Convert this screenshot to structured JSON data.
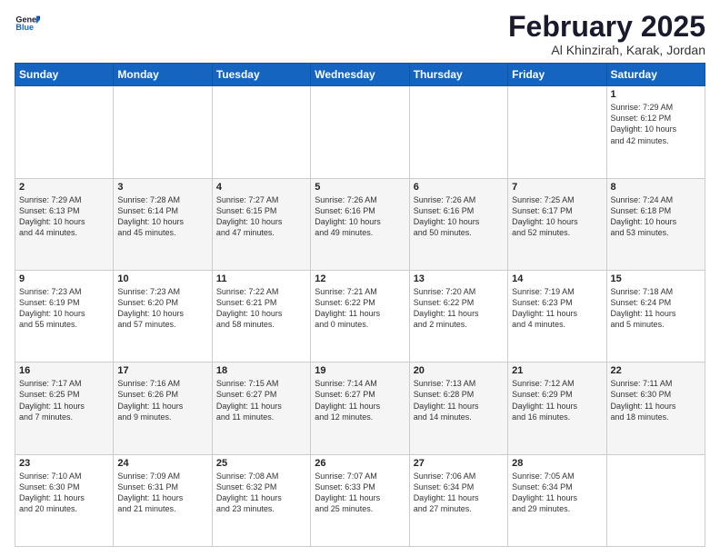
{
  "header": {
    "logo_line1": "General",
    "logo_line2": "Blue",
    "title": "February 2025",
    "subtitle": "Al Khinzirah, Karak, Jordan"
  },
  "weekdays": [
    "Sunday",
    "Monday",
    "Tuesday",
    "Wednesday",
    "Thursday",
    "Friday",
    "Saturday"
  ],
  "weeks": [
    [
      {
        "day": "",
        "info": ""
      },
      {
        "day": "",
        "info": ""
      },
      {
        "day": "",
        "info": ""
      },
      {
        "day": "",
        "info": ""
      },
      {
        "day": "",
        "info": ""
      },
      {
        "day": "",
        "info": ""
      },
      {
        "day": "1",
        "info": "Sunrise: 7:29 AM\nSunset: 6:12 PM\nDaylight: 10 hours\nand 42 minutes."
      }
    ],
    [
      {
        "day": "2",
        "info": "Sunrise: 7:29 AM\nSunset: 6:13 PM\nDaylight: 10 hours\nand 44 minutes."
      },
      {
        "day": "3",
        "info": "Sunrise: 7:28 AM\nSunset: 6:14 PM\nDaylight: 10 hours\nand 45 minutes."
      },
      {
        "day": "4",
        "info": "Sunrise: 7:27 AM\nSunset: 6:15 PM\nDaylight: 10 hours\nand 47 minutes."
      },
      {
        "day": "5",
        "info": "Sunrise: 7:26 AM\nSunset: 6:16 PM\nDaylight: 10 hours\nand 49 minutes."
      },
      {
        "day": "6",
        "info": "Sunrise: 7:26 AM\nSunset: 6:16 PM\nDaylight: 10 hours\nand 50 minutes."
      },
      {
        "day": "7",
        "info": "Sunrise: 7:25 AM\nSunset: 6:17 PM\nDaylight: 10 hours\nand 52 minutes."
      },
      {
        "day": "8",
        "info": "Sunrise: 7:24 AM\nSunset: 6:18 PM\nDaylight: 10 hours\nand 53 minutes."
      }
    ],
    [
      {
        "day": "9",
        "info": "Sunrise: 7:23 AM\nSunset: 6:19 PM\nDaylight: 10 hours\nand 55 minutes."
      },
      {
        "day": "10",
        "info": "Sunrise: 7:23 AM\nSunset: 6:20 PM\nDaylight: 10 hours\nand 57 minutes."
      },
      {
        "day": "11",
        "info": "Sunrise: 7:22 AM\nSunset: 6:21 PM\nDaylight: 10 hours\nand 58 minutes."
      },
      {
        "day": "12",
        "info": "Sunrise: 7:21 AM\nSunset: 6:22 PM\nDaylight: 11 hours\nand 0 minutes."
      },
      {
        "day": "13",
        "info": "Sunrise: 7:20 AM\nSunset: 6:22 PM\nDaylight: 11 hours\nand 2 minutes."
      },
      {
        "day": "14",
        "info": "Sunrise: 7:19 AM\nSunset: 6:23 PM\nDaylight: 11 hours\nand 4 minutes."
      },
      {
        "day": "15",
        "info": "Sunrise: 7:18 AM\nSunset: 6:24 PM\nDaylight: 11 hours\nand 5 minutes."
      }
    ],
    [
      {
        "day": "16",
        "info": "Sunrise: 7:17 AM\nSunset: 6:25 PM\nDaylight: 11 hours\nand 7 minutes."
      },
      {
        "day": "17",
        "info": "Sunrise: 7:16 AM\nSunset: 6:26 PM\nDaylight: 11 hours\nand 9 minutes."
      },
      {
        "day": "18",
        "info": "Sunrise: 7:15 AM\nSunset: 6:27 PM\nDaylight: 11 hours\nand 11 minutes."
      },
      {
        "day": "19",
        "info": "Sunrise: 7:14 AM\nSunset: 6:27 PM\nDaylight: 11 hours\nand 12 minutes."
      },
      {
        "day": "20",
        "info": "Sunrise: 7:13 AM\nSunset: 6:28 PM\nDaylight: 11 hours\nand 14 minutes."
      },
      {
        "day": "21",
        "info": "Sunrise: 7:12 AM\nSunset: 6:29 PM\nDaylight: 11 hours\nand 16 minutes."
      },
      {
        "day": "22",
        "info": "Sunrise: 7:11 AM\nSunset: 6:30 PM\nDaylight: 11 hours\nand 18 minutes."
      }
    ],
    [
      {
        "day": "23",
        "info": "Sunrise: 7:10 AM\nSunset: 6:30 PM\nDaylight: 11 hours\nand 20 minutes."
      },
      {
        "day": "24",
        "info": "Sunrise: 7:09 AM\nSunset: 6:31 PM\nDaylight: 11 hours\nand 21 minutes."
      },
      {
        "day": "25",
        "info": "Sunrise: 7:08 AM\nSunset: 6:32 PM\nDaylight: 11 hours\nand 23 minutes."
      },
      {
        "day": "26",
        "info": "Sunrise: 7:07 AM\nSunset: 6:33 PM\nDaylight: 11 hours\nand 25 minutes."
      },
      {
        "day": "27",
        "info": "Sunrise: 7:06 AM\nSunset: 6:34 PM\nDaylight: 11 hours\nand 27 minutes."
      },
      {
        "day": "28",
        "info": "Sunrise: 7:05 AM\nSunset: 6:34 PM\nDaylight: 11 hours\nand 29 minutes."
      },
      {
        "day": "",
        "info": ""
      }
    ]
  ]
}
